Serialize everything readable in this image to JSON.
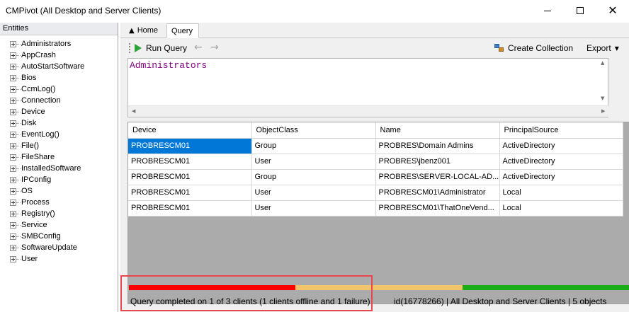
{
  "window": {
    "title": "CMPivot (All Desktop and Server Clients)",
    "minimize_glyph": "—",
    "close_glyph": "✕"
  },
  "entities": {
    "header": "Entities",
    "items": [
      "Administrators",
      "AppCrash",
      "AutoStartSoftware",
      "Bios",
      "CcmLog()",
      "Connection",
      "Device",
      "Disk",
      "EventLog()",
      "File()",
      "FileShare",
      "InstalledSoftware",
      "IPConfig",
      "OS",
      "Process",
      "Registry()",
      "Service",
      "SMBConfig",
      "SoftwareUpdate",
      "User"
    ]
  },
  "tabs": {
    "home": "Home",
    "query": "Query"
  },
  "toolbar": {
    "run_query": "Run Query",
    "back_arrow": "←",
    "forward_arrow": "→",
    "create_collection": "Create Collection",
    "export": "Export",
    "export_caret": "▼"
  },
  "editor": {
    "query_text": "Administrators"
  },
  "grid": {
    "columns": [
      "Device",
      "ObjectClass",
      "Name",
      "PrincipalSource"
    ],
    "rows": [
      [
        "PROBRESCM01",
        "Group",
        "PROBRES\\Domain Admins",
        "ActiveDirectory"
      ],
      [
        "PROBRESCM01",
        "User",
        "PROBRES\\jbenz001",
        "ActiveDirectory"
      ],
      [
        "PROBRESCM01",
        "Group",
        "PROBRES\\SERVER-LOCAL-AD...",
        "ActiveDirectory"
      ],
      [
        "PROBRESCM01",
        "User",
        "PROBRESCM01\\Administrator",
        "Local"
      ],
      [
        "PROBRESCM01",
        "User",
        "PROBRESCM01\\ThatOneVend...",
        "Local"
      ]
    ],
    "selected_row": 0,
    "selected_col": 0,
    "selected_color": "#0078d7"
  },
  "progress": {
    "segments": [
      {
        "status": "failure",
        "color": "#ff0000",
        "fraction": 0.3333
      },
      {
        "status": "offline",
        "color": "#f2c36b",
        "fraction": 0.3333
      },
      {
        "status": "completed",
        "color": "#1aad19",
        "fraction": 0.3334
      }
    ]
  },
  "status": {
    "message": "Query completed on 1 of 3 clients (1 clients offline and 1 failure)",
    "details": "id(16778266)  |  All Desktop and Server Clients  |  5 objects"
  },
  "annotation": {
    "highlight_color": "#e8474e"
  }
}
